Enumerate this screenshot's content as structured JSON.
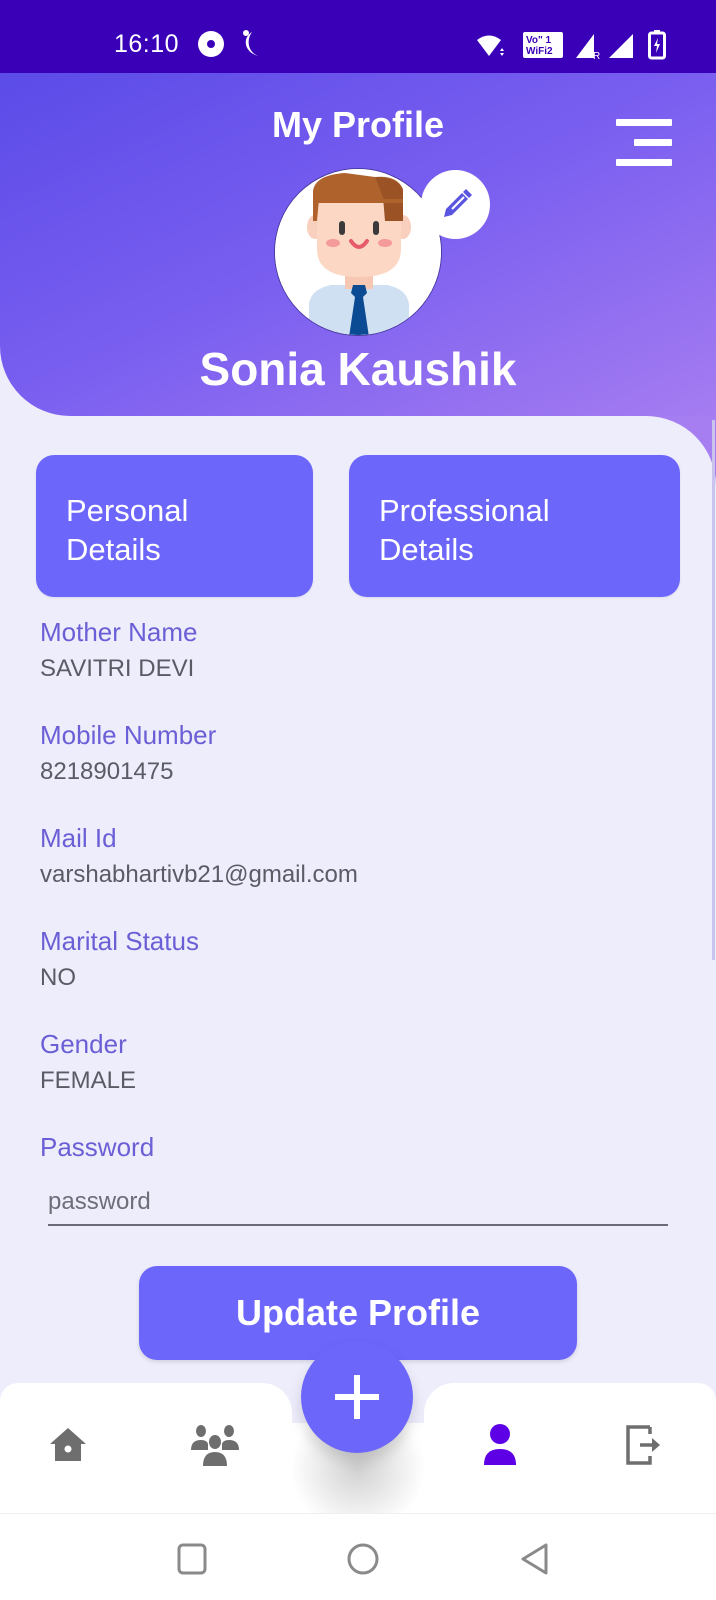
{
  "status_bar": {
    "time": "16:10",
    "icons": [
      "chrome-icon",
      "moon-icon",
      "wifi-icon",
      "vowifi-icon",
      "signal-icon",
      "signal-icon",
      "battery-charging-icon"
    ],
    "vowifi_text": "Vo\" 1 WiFi2",
    "signal_badge": "R"
  },
  "header": {
    "title": "My Profile",
    "menu_icon": "menu-icon",
    "edit_icon": "pencil-icon",
    "user_name": "Sonia Kaushik"
  },
  "tabs": [
    {
      "line1": "Personal",
      "line2": "Details",
      "active": true
    },
    {
      "line1": "Professional",
      "line2": "Details",
      "active": false
    }
  ],
  "fields": [
    {
      "label": "Mother Name",
      "value": "SAVITRI DEVI"
    },
    {
      "label": "Mobile Number",
      "value": "8218901475"
    },
    {
      "label": "Mail Id",
      "value": "varshabhartivb21@gmail.com"
    },
    {
      "label": "Marital Status",
      "value": "NO"
    },
    {
      "label": "Gender",
      "value": "FEMALE"
    }
  ],
  "password": {
    "label": "Password",
    "placeholder": "password",
    "value": ""
  },
  "update_button": "Update Profile",
  "bottom_nav": {
    "items": [
      {
        "icon": "home-icon",
        "active": false
      },
      {
        "icon": "group-icon",
        "active": false
      },
      {
        "icon": "add-icon",
        "active": false
      },
      {
        "icon": "person-icon",
        "active": true
      },
      {
        "icon": "logout-icon",
        "active": false
      }
    ]
  },
  "system_nav": [
    "recents-icon",
    "home-circle-icon",
    "back-icon"
  ],
  "colors": {
    "status_bar": "#3a00b8",
    "accent": "#6c66fb",
    "label": "#6b5fd6",
    "active_nav": "#5d00e6",
    "inactive_nav": "#6e6e6e",
    "background": "#eeedfc"
  }
}
